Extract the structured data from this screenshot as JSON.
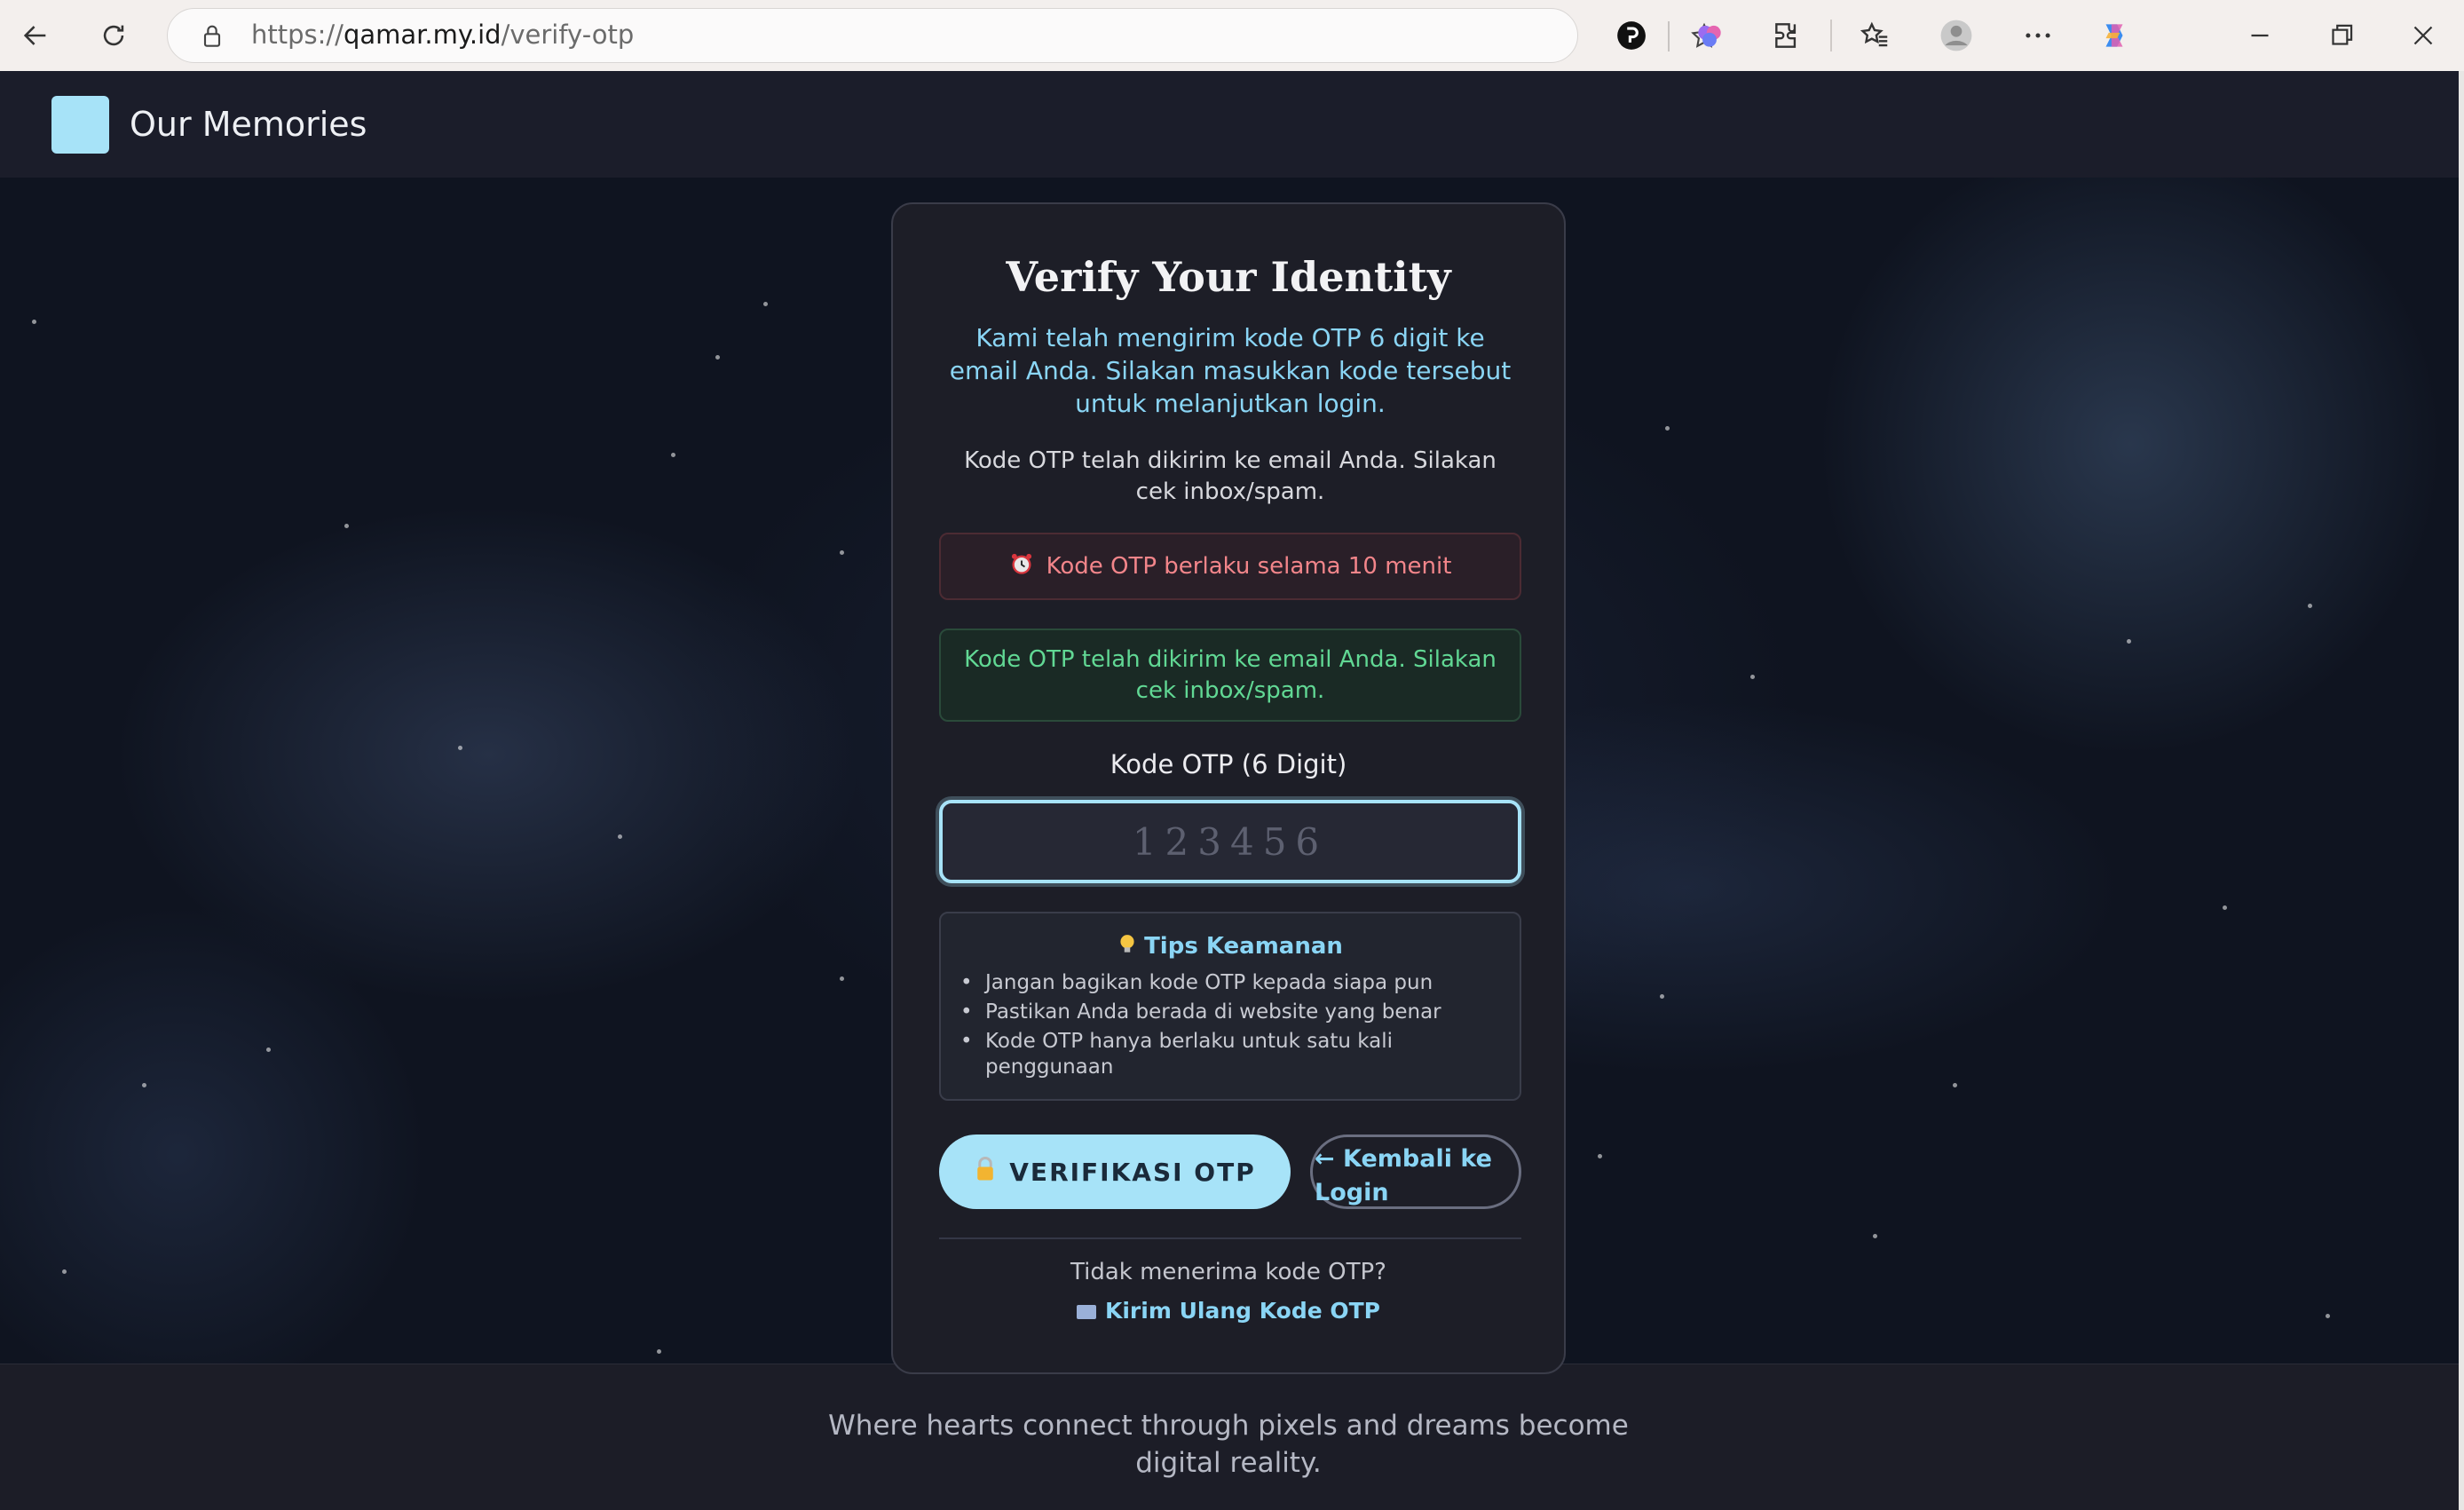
{
  "browser": {
    "url_scheme": "https://",
    "url_host": "qamar.my.id",
    "url_path": "/verify-otp"
  },
  "site": {
    "title": "Our Memories",
    "footer": "Where hearts connect through pixels and dreams become digital reality."
  },
  "card": {
    "title": "Verify Your Identity",
    "subtitle": "Kami telah mengirim kode OTP 6 digit ke email Anda. Silakan masukkan kode tersebut untuk melanjutkan login.",
    "info": "Kode OTP telah dikirim ke email Anda. Silakan cek inbox/spam.",
    "alert_expiry": "Kode OTP berlaku selama 10 menit",
    "alert_sent": "Kode OTP telah dikirim ke email Anda. Silakan cek inbox/spam.",
    "otp_label": "Kode OTP (6 Digit)",
    "otp_placeholder": "123456",
    "otp_value": "",
    "tips_title": "Tips Keamanan",
    "tips": [
      "Jangan bagikan kode OTP kepada siapa pun",
      "Pastikan Anda berada di website yang benar",
      "Kode OTP hanya berlaku untuk satu kali penggunaan"
    ],
    "verify_button": "VERIFIKASI OTP",
    "back_button": "← Kembali ke Login",
    "resend_question": "Tidak menerima kode OTP?",
    "resend_link": "Kirim Ulang Kode OTP"
  },
  "colors": {
    "accent": "#a7e3f8",
    "link": "#8ad5f5",
    "error": "#f2858a",
    "success": "#61d894"
  },
  "icons": [
    "back-arrow-icon",
    "refresh-icon",
    "lock-icon",
    "reading-mode-icon",
    "star-icon",
    "perplexity-icon",
    "brain-icon",
    "extensions-icon",
    "favorites-icon",
    "profile-icon",
    "more-icon",
    "copilot-icon",
    "minimize-icon",
    "restore-icon",
    "close-icon",
    "alarm-clock-icon",
    "lightbulb-icon",
    "padlock-icon",
    "envelope-icon"
  ]
}
